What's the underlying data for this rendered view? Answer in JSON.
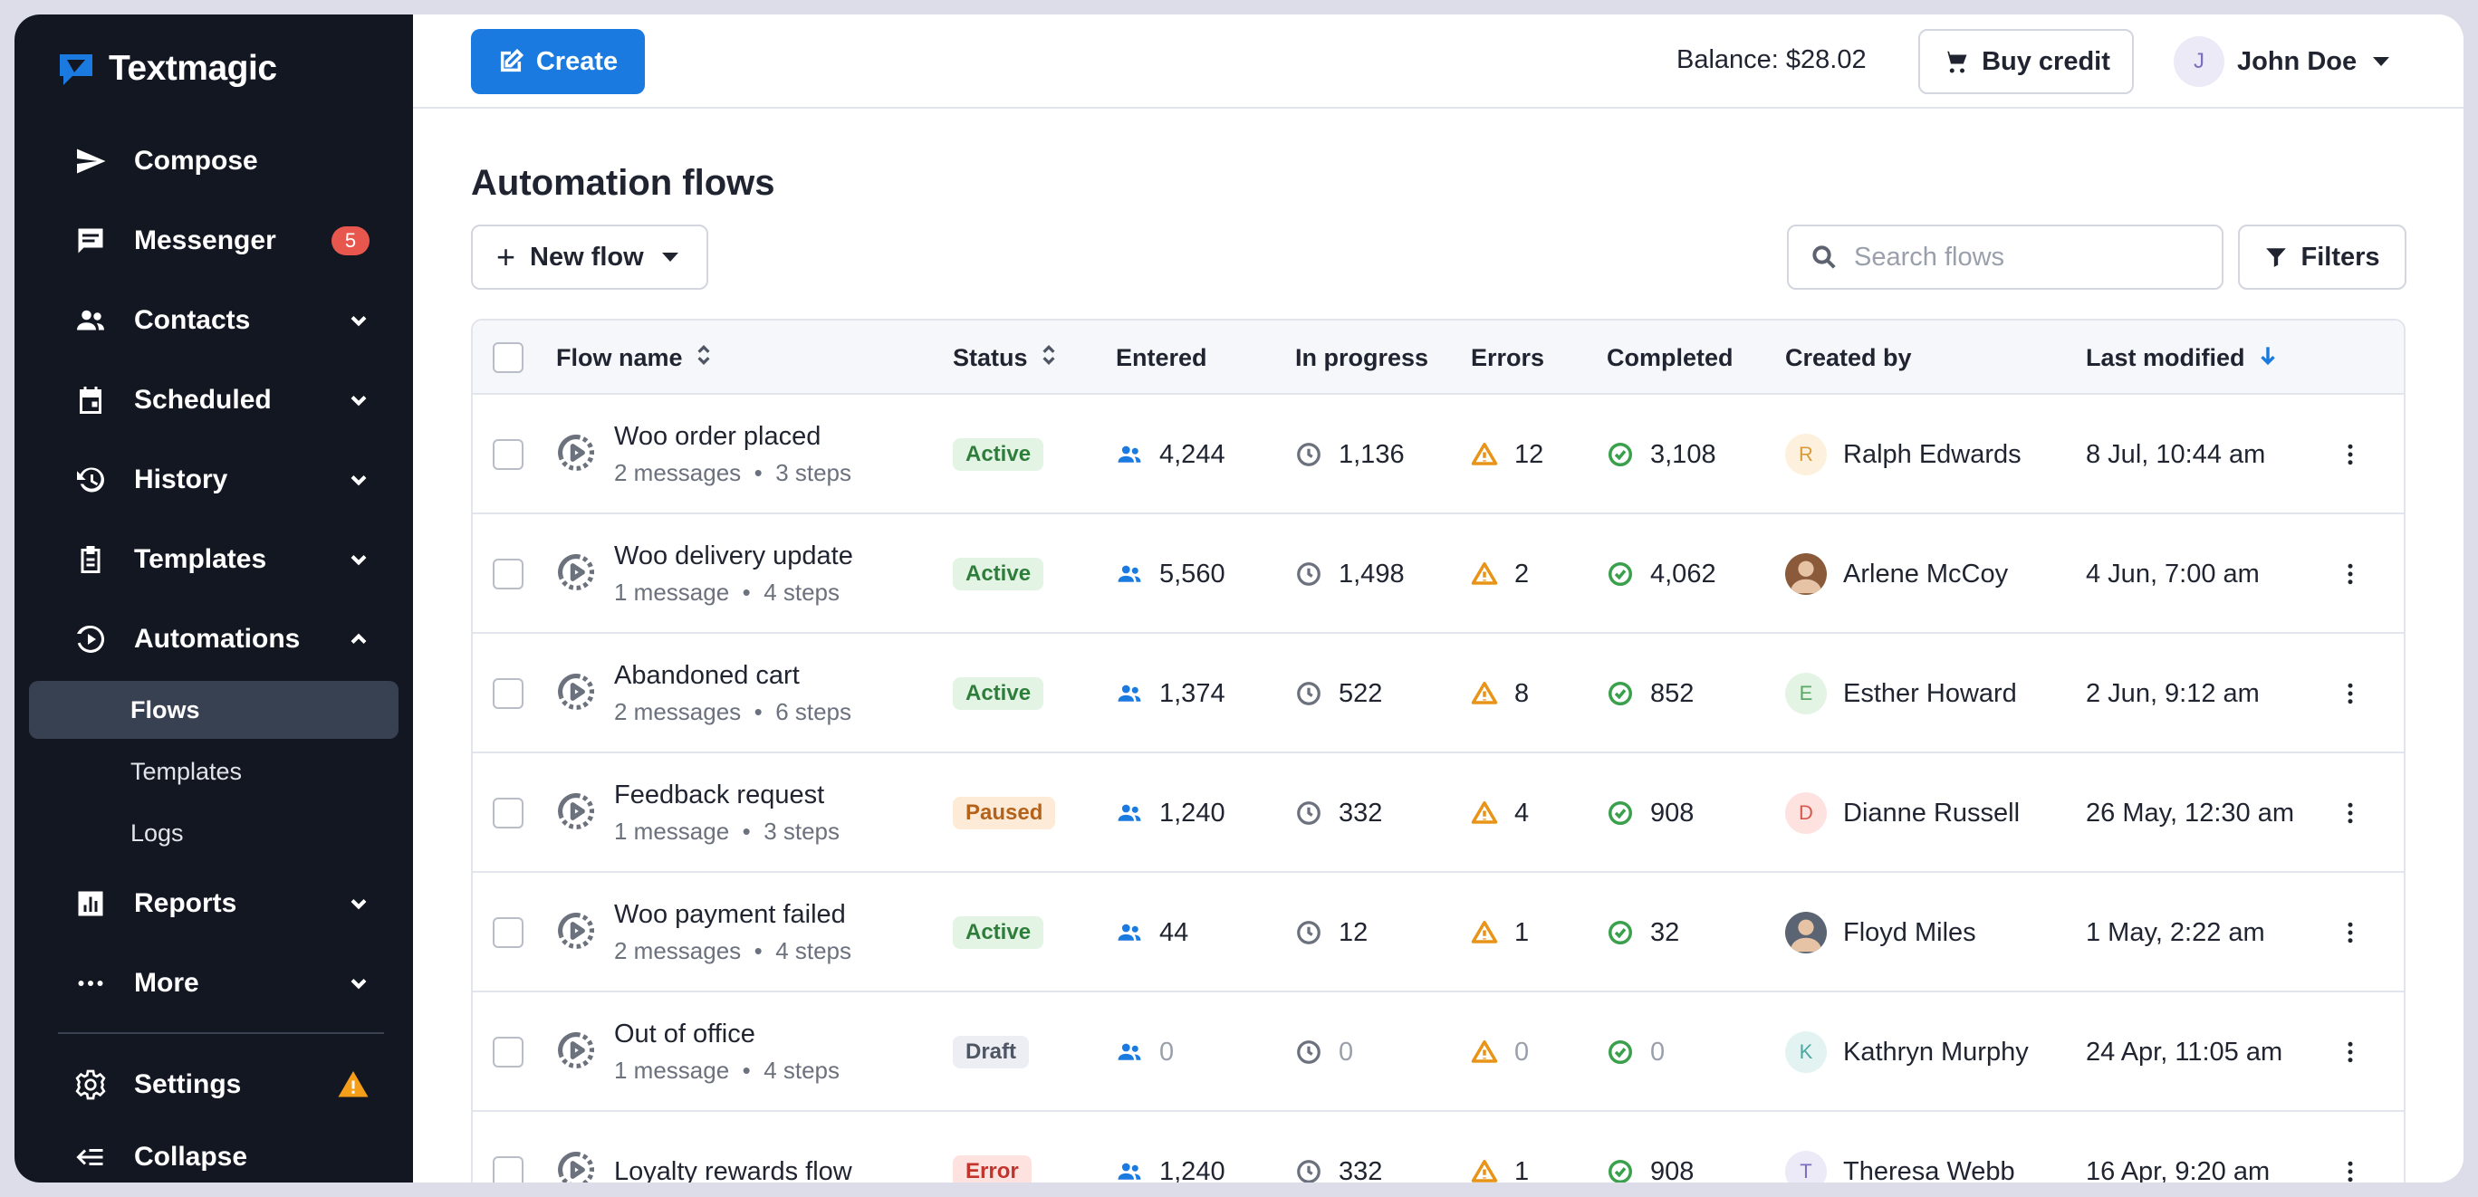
{
  "app": {
    "name": "Textmagic",
    "brand_color": "#1a7ae0"
  },
  "sidebar": {
    "nav": [
      {
        "label": "Compose",
        "icon": "send-icon"
      },
      {
        "label": "Messenger",
        "icon": "chat-icon",
        "badge": "5"
      },
      {
        "label": "Contacts",
        "icon": "people-icon"
      },
      {
        "label": "Scheduled",
        "icon": "calendar-icon"
      },
      {
        "label": "History",
        "icon": "history-icon"
      },
      {
        "label": "Templates",
        "icon": "clipboard-icon"
      },
      {
        "label": "Automations",
        "icon": "automation-icon"
      }
    ],
    "automations_sub": [
      {
        "label": "Flows",
        "active": true
      },
      {
        "label": "Templates",
        "active": false
      },
      {
        "label": "Logs",
        "active": false
      }
    ],
    "nav2": [
      {
        "label": "Reports",
        "icon": "chart-icon"
      },
      {
        "label": "More",
        "icon": "more-icon"
      }
    ],
    "settings_label": "Settings",
    "collapse_label": "Collapse"
  },
  "topbar": {
    "create_label": "Create",
    "balance": "Balance: $28.02",
    "buy_credit_label": "Buy credit",
    "user_initial": "J",
    "user_name": "John Doe"
  },
  "page": {
    "title": "Automation flows",
    "new_flow_label": "New flow",
    "search_placeholder": "Search flows",
    "filters_label": "Filters"
  },
  "table": {
    "columns": [
      "Flow name",
      "Status",
      "Entered",
      "In progress",
      "Errors",
      "Completed",
      "Created by",
      "Last modified"
    ],
    "rows": [
      {
        "name": "Woo order placed",
        "messages": "2 messages",
        "steps": "3 steps",
        "status": "Active",
        "entered": "4,244",
        "in_progress": "1,136",
        "errors": "12",
        "completed": "3,108",
        "creator": "Ralph Edwards",
        "creator_initial": "R",
        "creator_bg": "#fdf0dc",
        "creator_fg": "#d99a3a",
        "modified": "8 Jul, 10:44 am"
      },
      {
        "name": "Woo delivery update",
        "messages": "1 message",
        "steps": "4 steps",
        "status": "Active",
        "entered": "5,560",
        "in_progress": "1,498",
        "errors": "2",
        "completed": "4,062",
        "creator": "Arlene McCoy",
        "creator_initial": "",
        "creator_bg": "#8a5a3a",
        "creator_fg": "#fff",
        "modified": "4 Jun, 7:00 am"
      },
      {
        "name": "Abandoned cart",
        "messages": "2 messages",
        "steps": "6 steps",
        "status": "Active",
        "entered": "1,374",
        "in_progress": "522",
        "errors": "8",
        "completed": "852",
        "creator": "Esther Howard",
        "creator_initial": "E",
        "creator_bg": "#e3f4e5",
        "creator_fg": "#5aa866",
        "modified": "2 Jun, 9:12 am"
      },
      {
        "name": "Feedback request",
        "messages": "1 message",
        "steps": "3 steps",
        "status": "Paused",
        "entered": "1,240",
        "in_progress": "332",
        "errors": "4",
        "completed": "908",
        "creator": "Dianne Russell",
        "creator_initial": "D",
        "creator_bg": "#fde2e0",
        "creator_fg": "#d45a50",
        "modified": "26 May, 12:30 am"
      },
      {
        "name": "Woo payment failed",
        "messages": "2 messages",
        "steps": "4 steps",
        "status": "Active",
        "entered": "44",
        "in_progress": "12",
        "errors": "1",
        "completed": "32",
        "creator": "Floyd Miles",
        "creator_initial": "",
        "creator_bg": "#5b6472",
        "creator_fg": "#fff",
        "modified": "1 May, 2:22 am"
      },
      {
        "name": "Out of office",
        "messages": "1 message",
        "steps": "4 steps",
        "status": "Draft",
        "entered": "0",
        "in_progress": "0",
        "errors": "0",
        "completed": "0",
        "creator": "Kathryn Murphy",
        "creator_initial": "K",
        "creator_bg": "#e2f3f2",
        "creator_fg": "#4aa8a0",
        "modified": "24 Apr, 11:05 am"
      },
      {
        "name": "Loyalty rewards flow",
        "messages": "",
        "steps": "",
        "status": "Error",
        "entered": "1,240",
        "in_progress": "332",
        "errors": "1",
        "completed": "908",
        "creator": "Theresa Webb",
        "creator_initial": "T",
        "creator_bg": "#ebeaf6",
        "creator_fg": "#7b6fc0",
        "modified": "16 Apr, 9:20 am"
      }
    ]
  }
}
